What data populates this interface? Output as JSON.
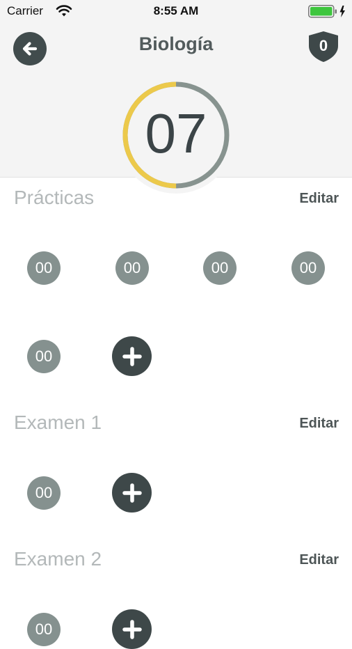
{
  "status_bar": {
    "carrier": "Carrier",
    "time": "8:55 AM"
  },
  "header": {
    "title": "Biología",
    "badge_count": "0"
  },
  "score": {
    "value": "07",
    "progress_fraction": 0.5,
    "progress_color": "#ecc94b",
    "track_color": "#87938f"
  },
  "sections": [
    {
      "title": "Prácticas",
      "edit_label": "Editar",
      "grades": [
        "00",
        "00",
        "00",
        "00",
        "00"
      ]
    },
    {
      "title": "Examen 1",
      "edit_label": "Editar",
      "grades": [
        "00"
      ]
    },
    {
      "title": "Examen 2",
      "edit_label": "Editar",
      "grades": [
        "00"
      ]
    }
  ],
  "icons": {
    "back": "arrow-left-icon",
    "badge": "shield-icon",
    "add": "plus-icon",
    "wifi": "wifi-icon",
    "battery": "battery-icon"
  },
  "colors": {
    "grade_bg": "#85918f",
    "button_dark": "#3e4849",
    "section_title": "#b3b8b9"
  }
}
